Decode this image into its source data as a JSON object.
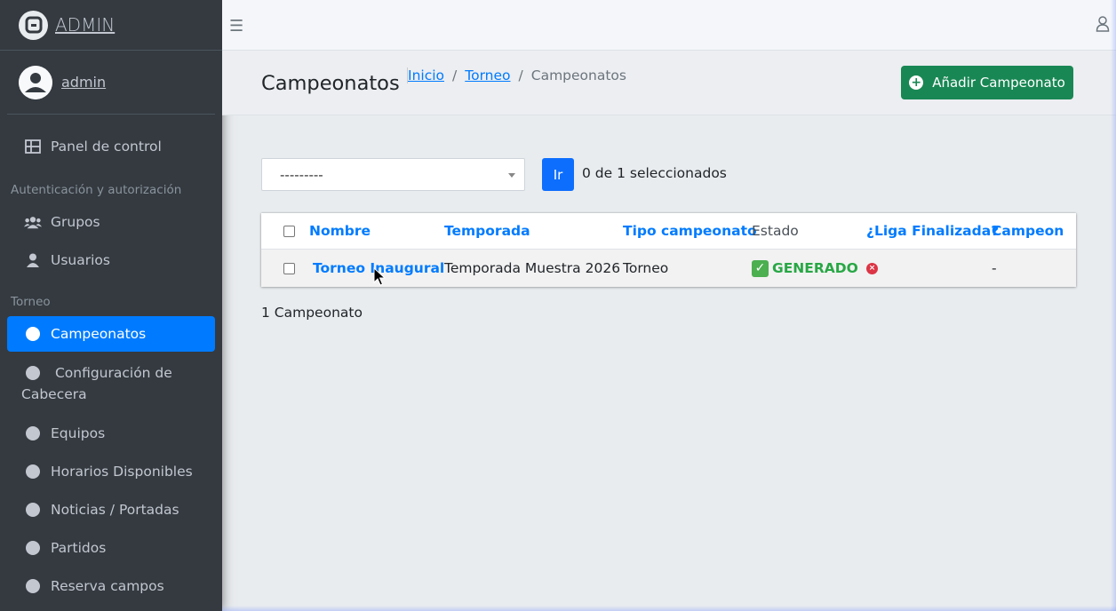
{
  "brand": {
    "text": "ADMIN"
  },
  "user": {
    "name": "admin"
  },
  "sidebar": {
    "dashboard": "Panel de control",
    "section_auth": "Autenticación y autorización",
    "auth_items": [
      "Grupos",
      "Usuarios"
    ],
    "section_torneo": "Torneo",
    "torneo_items": [
      "Campeonatos",
      "Configuración de Cabecera",
      "Equipos",
      "Horarios Disponibles",
      "Noticias / Portadas",
      "Partidos",
      "Reserva campos"
    ],
    "active_item": "Campeonatos"
  },
  "header": {
    "title": "Campeonatos",
    "breadcrumb": [
      "Inicio",
      "Torneo",
      "Campeonatos"
    ],
    "add_button": "Añadir Campeonato"
  },
  "actions": {
    "select_value": "---------",
    "go_label": "Ir",
    "selected_text": "0 de 1 seleccionados"
  },
  "table": {
    "columns": [
      "Nombre",
      "Temporada",
      "Tipo campeonato",
      "Estado",
      "¿Liga Finalizada?",
      "Campeon"
    ],
    "rows": [
      {
        "nombre": "Torneo Inaugural",
        "temporada": "Temporada Muestra 2026",
        "tipo": "Torneo",
        "estado": "GENERADO",
        "liga_finalizada": "no",
        "campeon": "-"
      }
    ]
  },
  "paginator": "1 Campeonato",
  "colors": {
    "sidebar": "#343a40",
    "accent": "#007bff",
    "success": "#198754",
    "status_green": "#28a745",
    "danger": "#dc3545"
  }
}
